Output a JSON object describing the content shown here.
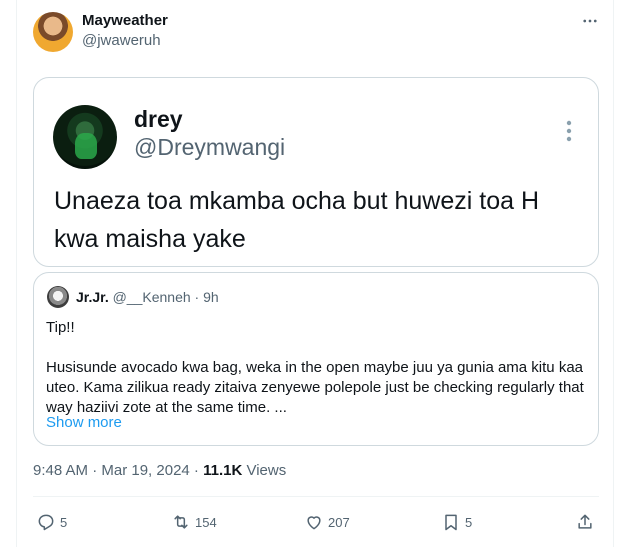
{
  "tweet": {
    "author_name": "Mayweather",
    "author_handle": "@jwaweruh",
    "timestamp": "9:48 AM · Mar 19, 2024",
    "separator": " · ",
    "views_count": "11.1K",
    "views_label": "Views"
  },
  "embedded_post": {
    "name": "drey",
    "handle": "@Dreymwangi",
    "text": "Unaeza toa mkamba ocha but huwezi toa H kwa maisha yake"
  },
  "quoted_post": {
    "name": "Jr.Jr.",
    "handle": "@__Kenneh",
    "time": "· 9h",
    "paragraph_1": "Tip!!",
    "paragraph_2": "Husisunde avocado kwa bag, weka  in the open maybe juu ya gunia ama kitu kaa uteo. Kama zilikua ready zitaiva zenyewe polepole just be checking regularly that way haziivi zote at the same time. ...",
    "show_more": "Show more"
  },
  "actions": {
    "replies": "5",
    "reposts": "154",
    "likes": "207",
    "bookmarks": "5"
  },
  "icons": {
    "more": "more-horizontal-icon",
    "embed_more": "more-vertical-icon",
    "reply": "reply-icon",
    "repost": "repost-icon",
    "like": "heart-icon",
    "bookmark": "bookmark-icon",
    "share": "share-icon"
  },
  "colors": {
    "text": "#0f1419",
    "secondary": "#536471",
    "link": "#1d9bf0",
    "border": "#cfd9de"
  }
}
